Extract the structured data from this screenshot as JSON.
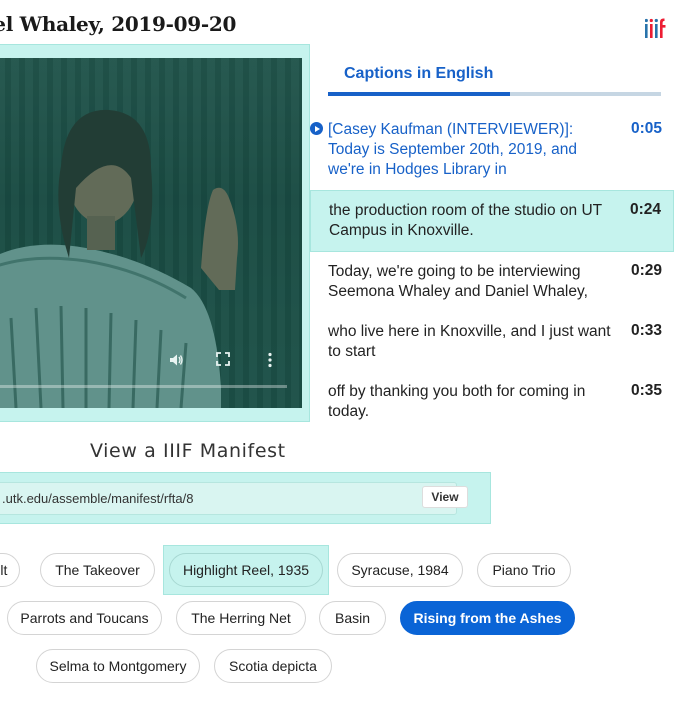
{
  "page": {
    "title": "iel Whaley, 2019-09-20"
  },
  "icons": {
    "iiif_logo": "iiif-logo-icon",
    "volume": "volume-icon",
    "fullscreen": "fullscreen-icon",
    "more": "more-vert-icon"
  },
  "colors": {
    "accent": "#1761c8",
    "highlight": "#c6f3ee",
    "active_chip": "#0a64d6"
  },
  "tabs": [
    {
      "label": "Captions in English",
      "active": true
    }
  ],
  "captions": [
    {
      "text": "[Casey Kaufman (INTERVIEWER)]: Today is September 20th, 2019, and we're in Hodges Library in",
      "time": "0:05",
      "state": "playing"
    },
    {
      "text": "the production room of the studio on UT Campus in Knoxville.",
      "time": "0:24",
      "state": "current"
    },
    {
      "text": "Today, we're going to be interviewing Seemona Whaley and Daniel Whaley,",
      "time": "0:29",
      "state": ""
    },
    {
      "text": "who live here in Knoxville, and I just want to start",
      "time": "0:33",
      "state": ""
    },
    {
      "text": "off by thanking you both for coming in today.",
      "time": "0:35",
      "state": ""
    }
  ],
  "manifest": {
    "heading": "View a IIIF Manifest",
    "url": ".utk.edu/assemble/manifest/rfta/8",
    "view_label": "View"
  },
  "chips": {
    "row1": [
      "ult",
      "The Takeover",
      "Highlight Reel, 1935",
      "Syracuse, 1984",
      "Piano Trio"
    ],
    "row2": [
      "Parrots and Toucans",
      "The Herring Net",
      "Basin",
      "Rising from the Ashes"
    ],
    "row3": [
      "Selma to Montgomery",
      "Scotia depicta"
    ]
  }
}
